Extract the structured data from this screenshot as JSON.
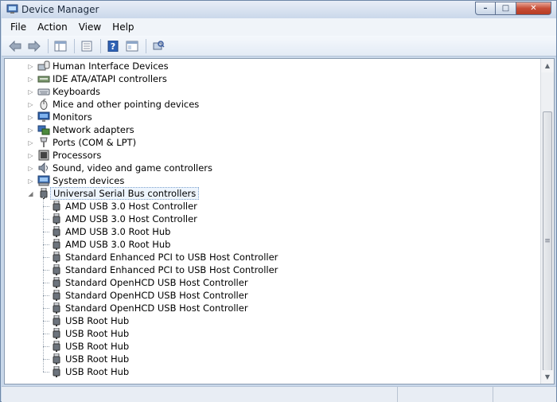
{
  "window": {
    "title": "Device Manager"
  },
  "caption": {
    "minimize": "–",
    "maximize": "□",
    "close": "✕"
  },
  "menu": [
    "File",
    "Action",
    "View",
    "Help"
  ],
  "toolbar": {
    "icons": [
      "back-arrow-icon",
      "forward-arrow-icon",
      "show-hide-tree-icon",
      "properties-icon",
      "help-icon",
      "view-resources-icon",
      "scan-hardware-icon"
    ]
  },
  "tree": {
    "categories": [
      {
        "label": "Human Interface Devices",
        "icon": "hid-icon",
        "expanded": false
      },
      {
        "label": "IDE ATA/ATAPI controllers",
        "icon": "ide-controller-icon",
        "expanded": false
      },
      {
        "label": "Keyboards",
        "icon": "keyboard-icon",
        "expanded": false
      },
      {
        "label": "Mice and other pointing devices",
        "icon": "mouse-icon",
        "expanded": false
      },
      {
        "label": "Monitors",
        "icon": "monitor-icon",
        "expanded": false
      },
      {
        "label": "Network adapters",
        "icon": "network-adapter-icon",
        "expanded": false
      },
      {
        "label": "Ports (COM & LPT)",
        "icon": "port-icon",
        "expanded": false
      },
      {
        "label": "Processors",
        "icon": "processor-icon",
        "expanded": false
      },
      {
        "label": "Sound, video and game controllers",
        "icon": "sound-icon",
        "expanded": false
      },
      {
        "label": "System devices",
        "icon": "system-device-icon",
        "expanded": false
      },
      {
        "label": "Universal Serial Bus controllers",
        "icon": "usb-icon",
        "expanded": true,
        "selected": true
      }
    ],
    "usb_children": [
      "AMD USB 3.0 Host Controller",
      "AMD USB 3.0 Host Controller",
      "AMD USB 3.0 Root Hub",
      "AMD USB 3.0 Root Hub",
      "Standard Enhanced PCI to USB Host Controller",
      "Standard Enhanced PCI to USB Host Controller",
      "Standard OpenHCD USB Host Controller",
      "Standard OpenHCD USB Host Controller",
      "Standard OpenHCD USB Host Controller",
      "USB Root Hub",
      "USB Root Hub",
      "USB Root Hub",
      "USB Root Hub",
      "USB Root Hub"
    ]
  },
  "scrollbar": {
    "thumb_grip": "≡",
    "up": "▲",
    "down": "▼"
  },
  "expander": {
    "collapsed": "▷",
    "expanded": "◢"
  }
}
